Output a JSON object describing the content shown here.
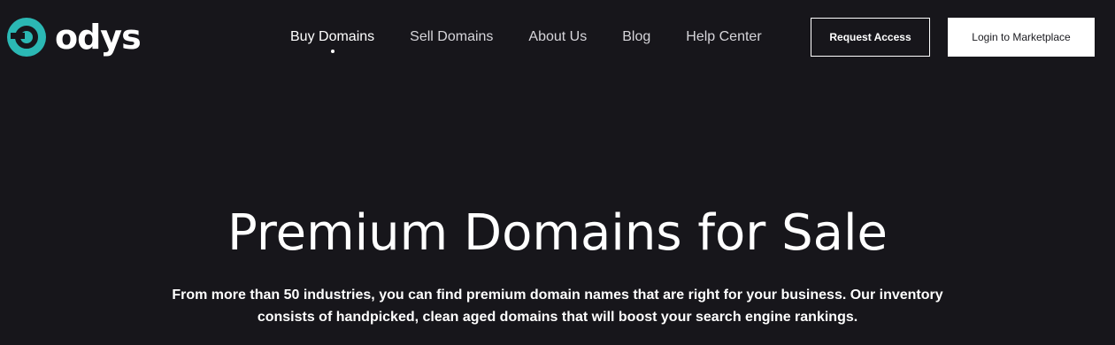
{
  "brand": {
    "name": "odys",
    "accent_color": "#2bb8b4",
    "logo_icon": "odys-logo-icon"
  },
  "nav": {
    "items": [
      {
        "label": "Buy Domains",
        "active": true
      },
      {
        "label": "Sell Domains",
        "active": false
      },
      {
        "label": "About Us",
        "active": false
      },
      {
        "label": "Blog",
        "active": false
      },
      {
        "label": "Help Center",
        "active": false
      }
    ]
  },
  "header_buttons": {
    "request_access": "Request Access",
    "login": "Login to Marketplace"
  },
  "hero": {
    "title": "Premium Domains for Sale",
    "subtitle": "From more than 50 industries, you can find premium domain names that are right for your business. Our inventory consists of handpicked, clean aged domains that will boost your search engine rankings."
  },
  "colors": {
    "background": "#17161b",
    "text": "#ffffff",
    "nav_text": "#d6d5da"
  }
}
